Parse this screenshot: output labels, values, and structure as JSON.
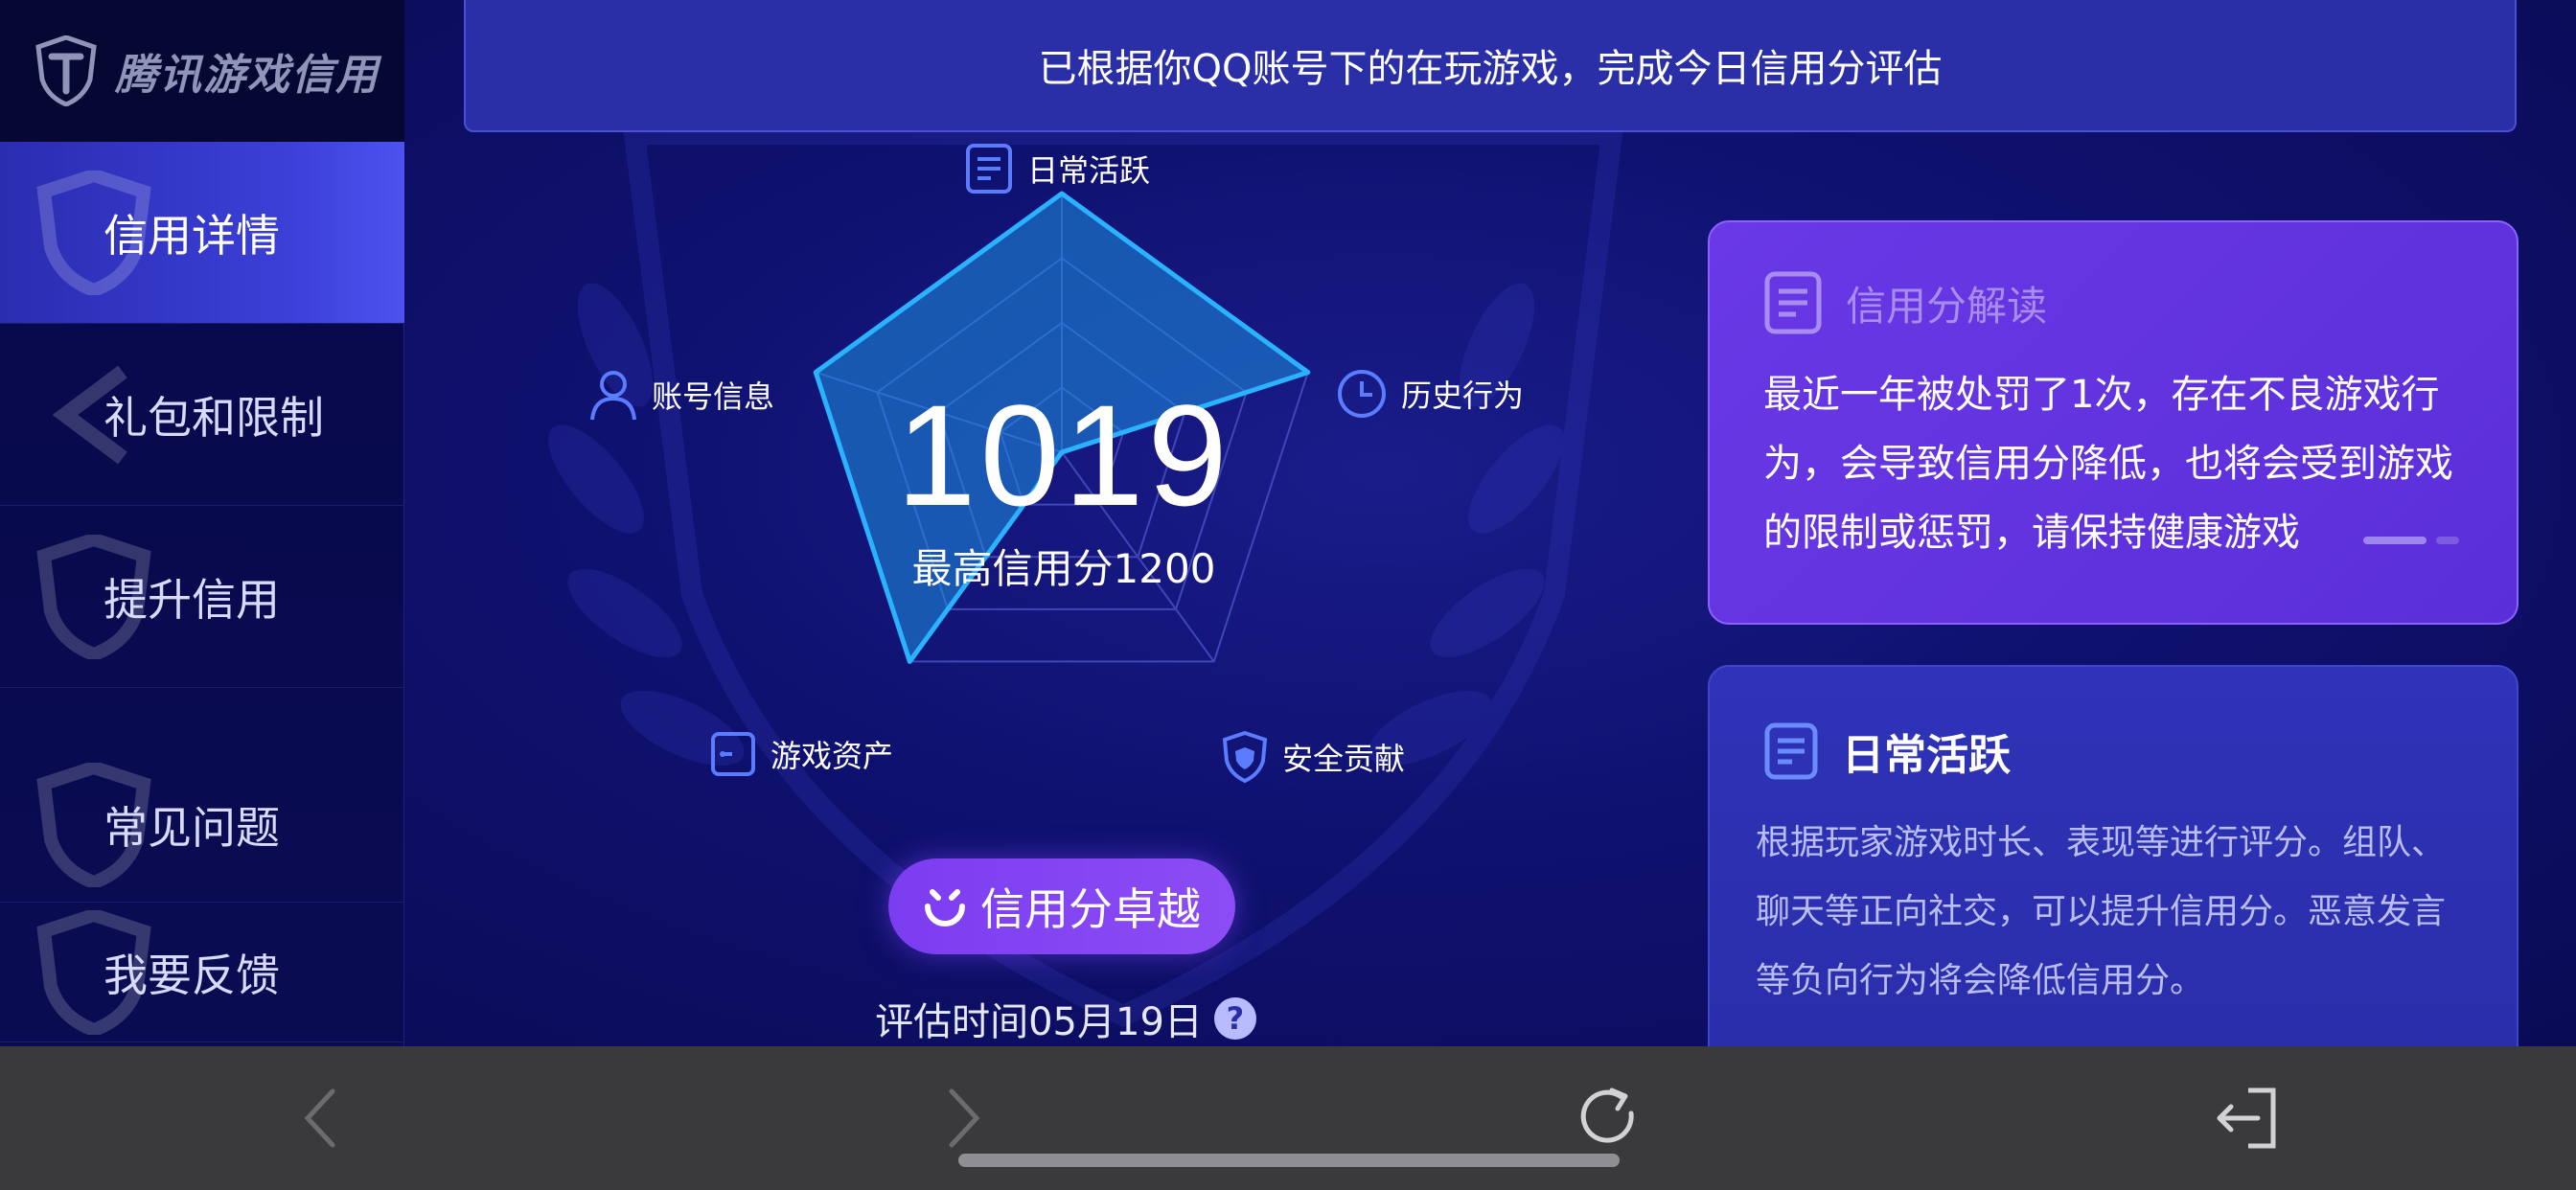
{
  "app": {
    "logo_text": "腾讯游戏信用"
  },
  "sidebar": {
    "items": [
      {
        "label": "信用详情",
        "active": true
      },
      {
        "label": "礼包和限制",
        "active": false
      },
      {
        "label": "提升信用",
        "active": false
      },
      {
        "label": "常见问题",
        "active": false
      },
      {
        "label": "我要反馈",
        "active": false
      }
    ]
  },
  "banner": {
    "text": "已根据你QQ账号下的在玩游戏，完成今日信用分评估"
  },
  "radar": {
    "score": "1019",
    "max_score_text": "最高信用分1200",
    "axes": [
      {
        "label": "日常活跃",
        "icon": "document-icon",
        "value": 1.0
      },
      {
        "label": "历史行为",
        "icon": "clock-icon",
        "value": 1.0
      },
      {
        "label": "安全贡献",
        "icon": "shield-icon",
        "value": 0.0
      },
      {
        "label": "游戏资产",
        "icon": "wallet-icon",
        "value": 1.0
      },
      {
        "label": "账号信息",
        "icon": "user-icon",
        "value": 1.0
      }
    ],
    "fill_color": "#1d8fe0",
    "stroke_color": "#2ab2ff"
  },
  "rating_button": {
    "label": "信用分卓越"
  },
  "evaluation": {
    "text": "评估时间05月19日",
    "help": "?"
  },
  "card_interpret": {
    "title": "信用分解读",
    "body": "最近一年被处罚了1次，存在不良游戏行为，会导致信用分降低，也将会受到游戏的限制或惩罚，请保持健康游戏"
  },
  "card_daily": {
    "title": "日常活跃",
    "body": "根据玩家游戏时长、表现等进行评分。组队、聊天等正向社交，可以提升信用分。恶意发言等负向行为将会降低信用分。"
  },
  "colors": {
    "background": "#0d0f5e",
    "accent_purple": "#7b3df0",
    "banner": "#2a2fa8",
    "bottom_bar": "#3a3a3c"
  }
}
